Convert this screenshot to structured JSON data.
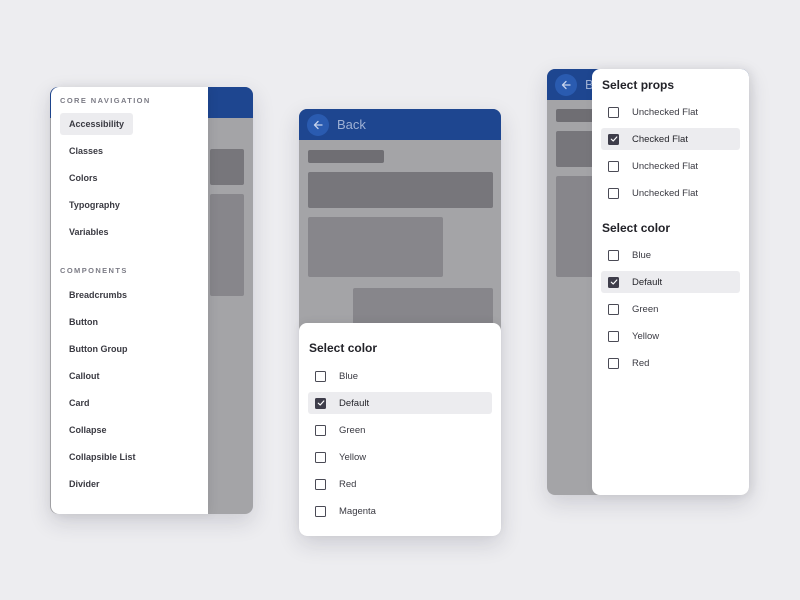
{
  "colors": {
    "background": "#ededf0",
    "appbar": "#1e4690",
    "scrim": "#a4a4a7",
    "checkbox_checked": "#3e3d4a",
    "active_row": "#ececef"
  },
  "panel_nav": {
    "appbar": {
      "back_icon": "arrow-left-icon"
    },
    "sections": [
      {
        "label": "CORE NAVIGATION",
        "items": [
          {
            "label": "Accessibility",
            "active": true
          },
          {
            "label": "Classes"
          },
          {
            "label": "Colors"
          },
          {
            "label": "Typography"
          },
          {
            "label": "Variables"
          }
        ]
      },
      {
        "label": "COMPONENTS",
        "items": [
          {
            "label": "Breadcrumbs"
          },
          {
            "label": "Button"
          },
          {
            "label": "Button Group"
          },
          {
            "label": "Callout"
          },
          {
            "label": "Card"
          },
          {
            "label": "Collapse"
          },
          {
            "label": "Collapsible List"
          },
          {
            "label": "Divider"
          }
        ]
      }
    ]
  },
  "panel_sheet": {
    "appbar": {
      "back_icon": "arrow-left-icon",
      "back_label": "Back"
    },
    "sheet": {
      "title": "Select color",
      "options": [
        {
          "label": "Blue",
          "checked": false
        },
        {
          "label": "Default",
          "checked": true
        },
        {
          "label": "Green",
          "checked": false
        },
        {
          "label": "Yellow",
          "checked": false
        },
        {
          "label": "Red",
          "checked": false
        },
        {
          "label": "Magenta",
          "checked": false
        }
      ]
    }
  },
  "panel_props": {
    "appbar": {
      "back_icon": "arrow-left-icon",
      "back_label": "B"
    },
    "groups": [
      {
        "title": "Select props",
        "options": [
          {
            "label": "Unchecked Flat",
            "checked": false
          },
          {
            "label": "Checked Flat",
            "checked": true
          },
          {
            "label": "Unchecked Flat",
            "checked": false
          },
          {
            "label": "Unchecked Flat",
            "checked": false
          }
        ]
      },
      {
        "title": "Select color",
        "options": [
          {
            "label": "Blue",
            "checked": false
          },
          {
            "label": "Default",
            "checked": true
          },
          {
            "label": "Green",
            "checked": false
          },
          {
            "label": "Yellow",
            "checked": false
          },
          {
            "label": "Red",
            "checked": false
          }
        ]
      }
    ]
  }
}
